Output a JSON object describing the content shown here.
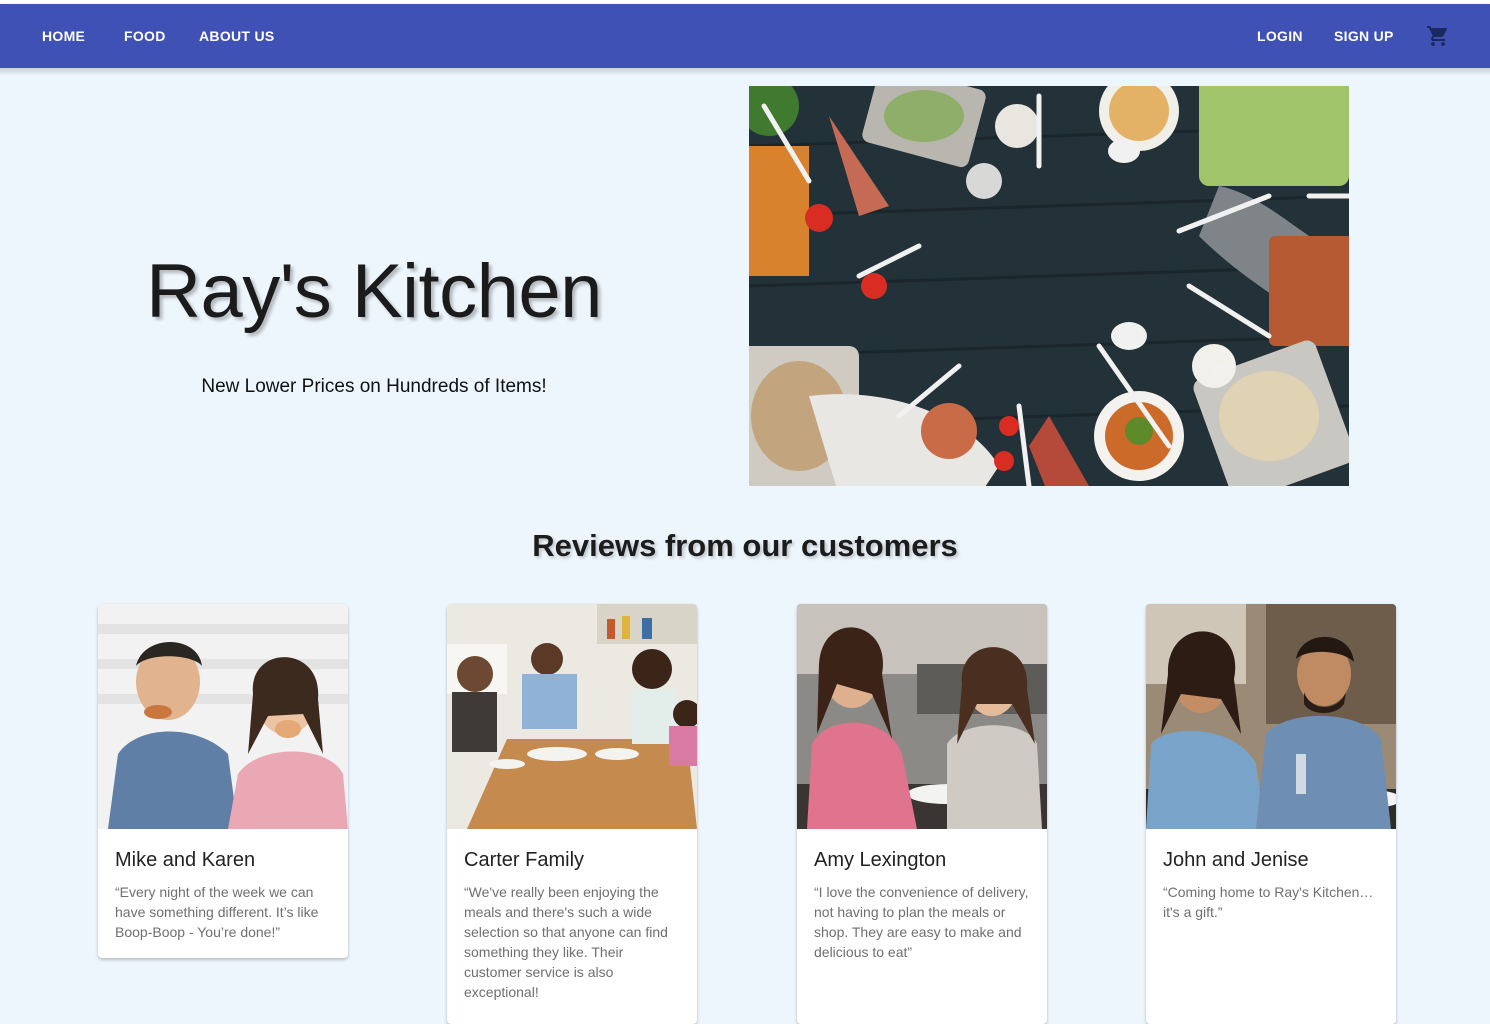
{
  "nav": {
    "home": "HOME",
    "food": "FOOD",
    "about": "ABOUT US",
    "login": "LOGIN",
    "signup": "SIGN UP",
    "cart_icon": "shopping-cart-icon"
  },
  "hero": {
    "title": "Ray's Kitchen",
    "subtitle": "New Lower Prices on Hundreds of Items!"
  },
  "reviews": {
    "heading": "Reviews from our customers",
    "cards": [
      {
        "name": "Mike and Karen",
        "quote": "“Every night of the week we can have something different. It’s like Boop-Boop - You’re done!”"
      },
      {
        "name": "Carter Family",
        "quote": "“We've really been enjoying the meals and there's such a wide selection so that anyone can find something they like. Their customer service is also exceptional!"
      },
      {
        "name": "Amy Lexington",
        "quote": "“I love the convenience of delivery, not having to plan the meals or shop. They are easy to make and delicious to eat”"
      },
      {
        "name": "John and Jenise",
        "quote": "“Coming home to Ray's Kitchen… it's a gift.”"
      }
    ]
  },
  "colors": {
    "navbar": "#3f51b5",
    "page_background": "#eef6fd",
    "card_text": "#6f6f6f"
  }
}
